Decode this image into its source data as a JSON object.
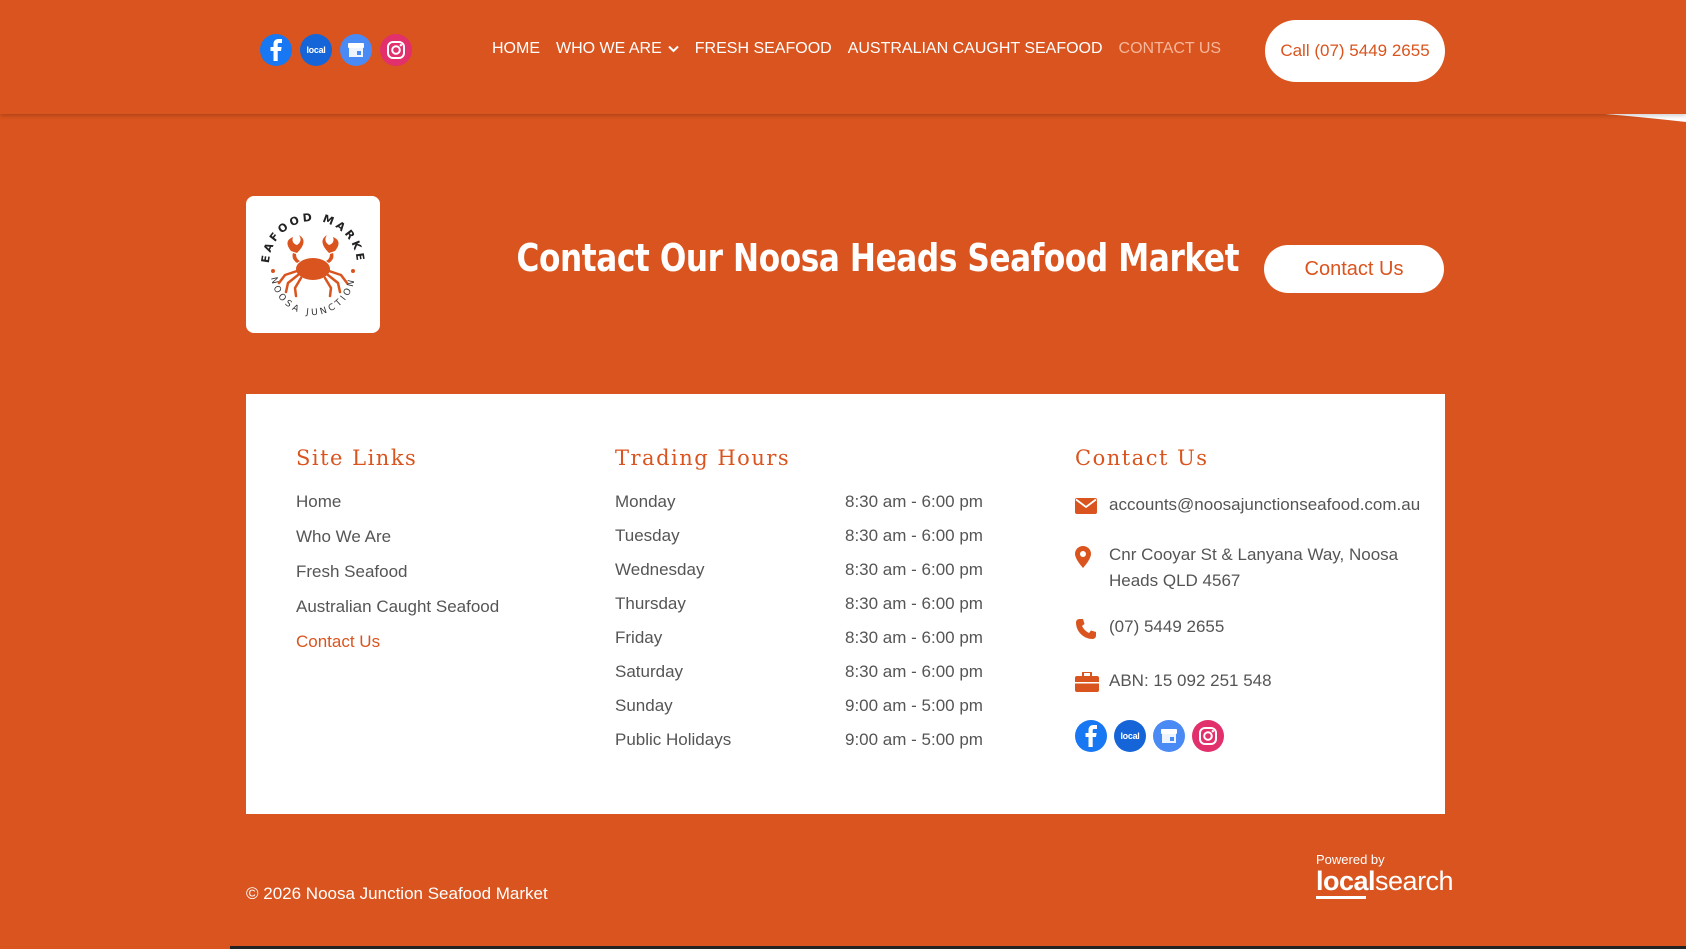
{
  "header": {
    "social": [
      {
        "name": "facebook-icon"
      },
      {
        "name": "localsearch-icon",
        "label": "local"
      },
      {
        "name": "google-business-icon"
      },
      {
        "name": "instagram-icon"
      }
    ],
    "nav": [
      {
        "label": "HOME",
        "active": false
      },
      {
        "label": "WHO WE ARE",
        "active": false,
        "dropdown": true
      },
      {
        "label": "FRESH SEAFOOD",
        "active": false
      },
      {
        "label": "AUSTRALIAN CAUGHT SEAFOOD",
        "active": false
      },
      {
        "label": "CONTACT US",
        "active": true
      }
    ],
    "call_label": "Call (07) 5449 2655"
  },
  "hero": {
    "logo_top_text": "SEAFOOD MARKET",
    "logo_bottom_text": "NOOSA JUNCTION",
    "title": "Contact Our Noosa Heads Seafood Market",
    "contact_button": "Contact Us"
  },
  "footer": {
    "links": {
      "title": "Site Links",
      "items": [
        "Home",
        "Who We Are",
        "Fresh Seafood",
        "Australian Caught Seafood",
        "Contact Us"
      ],
      "active_index": 4
    },
    "hours": {
      "title": "Trading Hours",
      "rows": [
        {
          "day": "Monday",
          "time": "8:30 am - 6:00 pm"
        },
        {
          "day": "Tuesday",
          "time": "8:30 am - 6:00 pm"
        },
        {
          "day": "Wednesday",
          "time": "8:30 am - 6:00 pm"
        },
        {
          "day": "Thursday",
          "time": "8:30 am - 6:00 pm"
        },
        {
          "day": "Friday",
          "time": "8:30 am - 6:00 pm"
        },
        {
          "day": "Saturday",
          "time": "8:30 am - 6:00 pm"
        },
        {
          "day": "Sunday",
          "time": "9:00 am - 5:00 pm"
        },
        {
          "day": "Public Holidays",
          "time": "9:00 am - 5:00 pm"
        }
      ]
    },
    "contact": {
      "title": "Contact Us",
      "email": "accounts@noosajunctionseafood.com.au",
      "address": "Cnr Cooyar St & Lanyana Way, Noosa Heads QLD 4567",
      "phone": "(07) 5449 2655",
      "abn": "ABN: 15 092 251 548"
    },
    "copyright": "© 2026 Noosa Junction Seafood Market",
    "powered_by": "Powered by",
    "brand_bold": "local",
    "brand_rest": "search"
  },
  "colors": {
    "brand": "#d9541e",
    "nav_active": "#f7b79a",
    "text_muted": "#555555"
  }
}
